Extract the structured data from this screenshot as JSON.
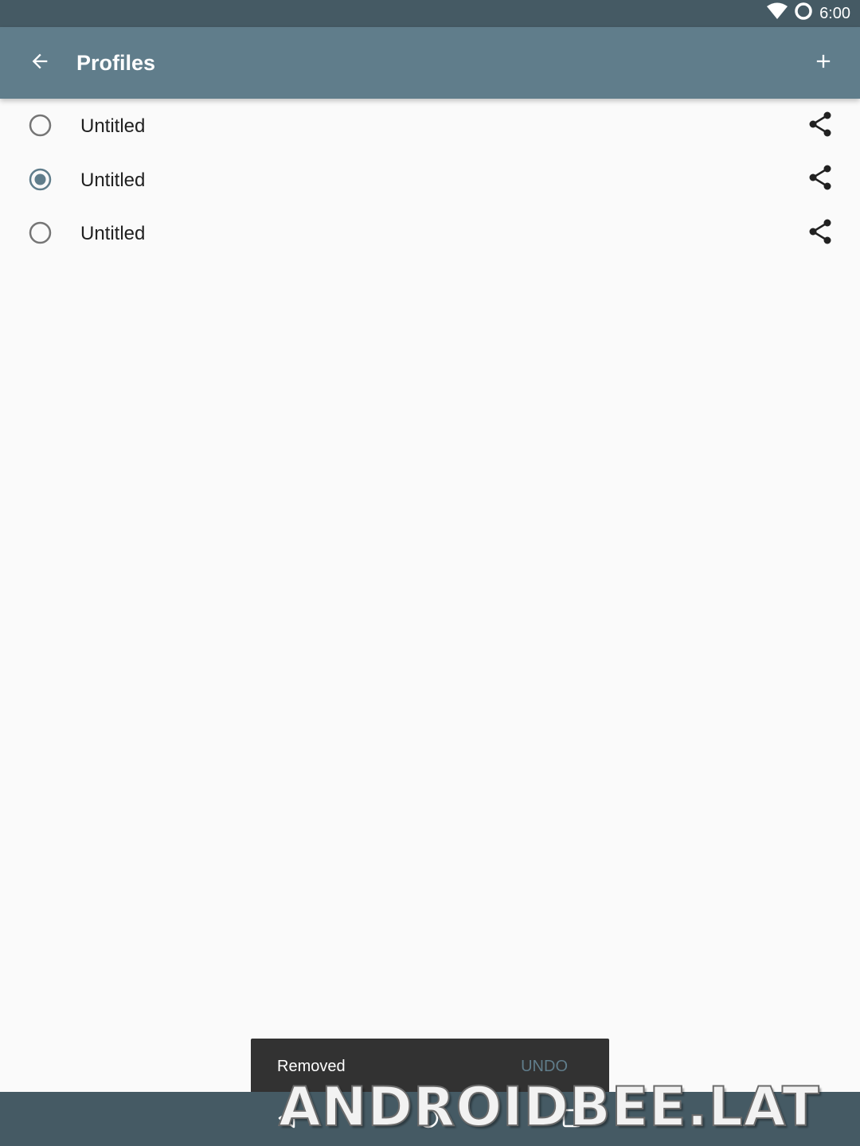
{
  "status_bar": {
    "time": "6:00",
    "icons": [
      "wifi-icon",
      "ring-icon"
    ]
  },
  "app_bar": {
    "title": "Profiles",
    "back_icon": "arrow-left-icon",
    "add_icon": "plus-icon",
    "background": "#607d8b"
  },
  "profiles": [
    {
      "label": "Untitled",
      "selected": false
    },
    {
      "label": "Untitled",
      "selected": true
    },
    {
      "label": "Untitled",
      "selected": false
    }
  ],
  "snackbar": {
    "message": "Removed",
    "action": "UNDO"
  },
  "nav_bar": {
    "buttons": [
      "back-triangle-icon",
      "home-circle-icon",
      "recents-square-icon"
    ]
  },
  "watermark": "ANDROIDBEE.LAT",
  "colors": {
    "accent": "#607d8b",
    "status_bar": "#455a64",
    "radio_unselected": "#757575"
  }
}
